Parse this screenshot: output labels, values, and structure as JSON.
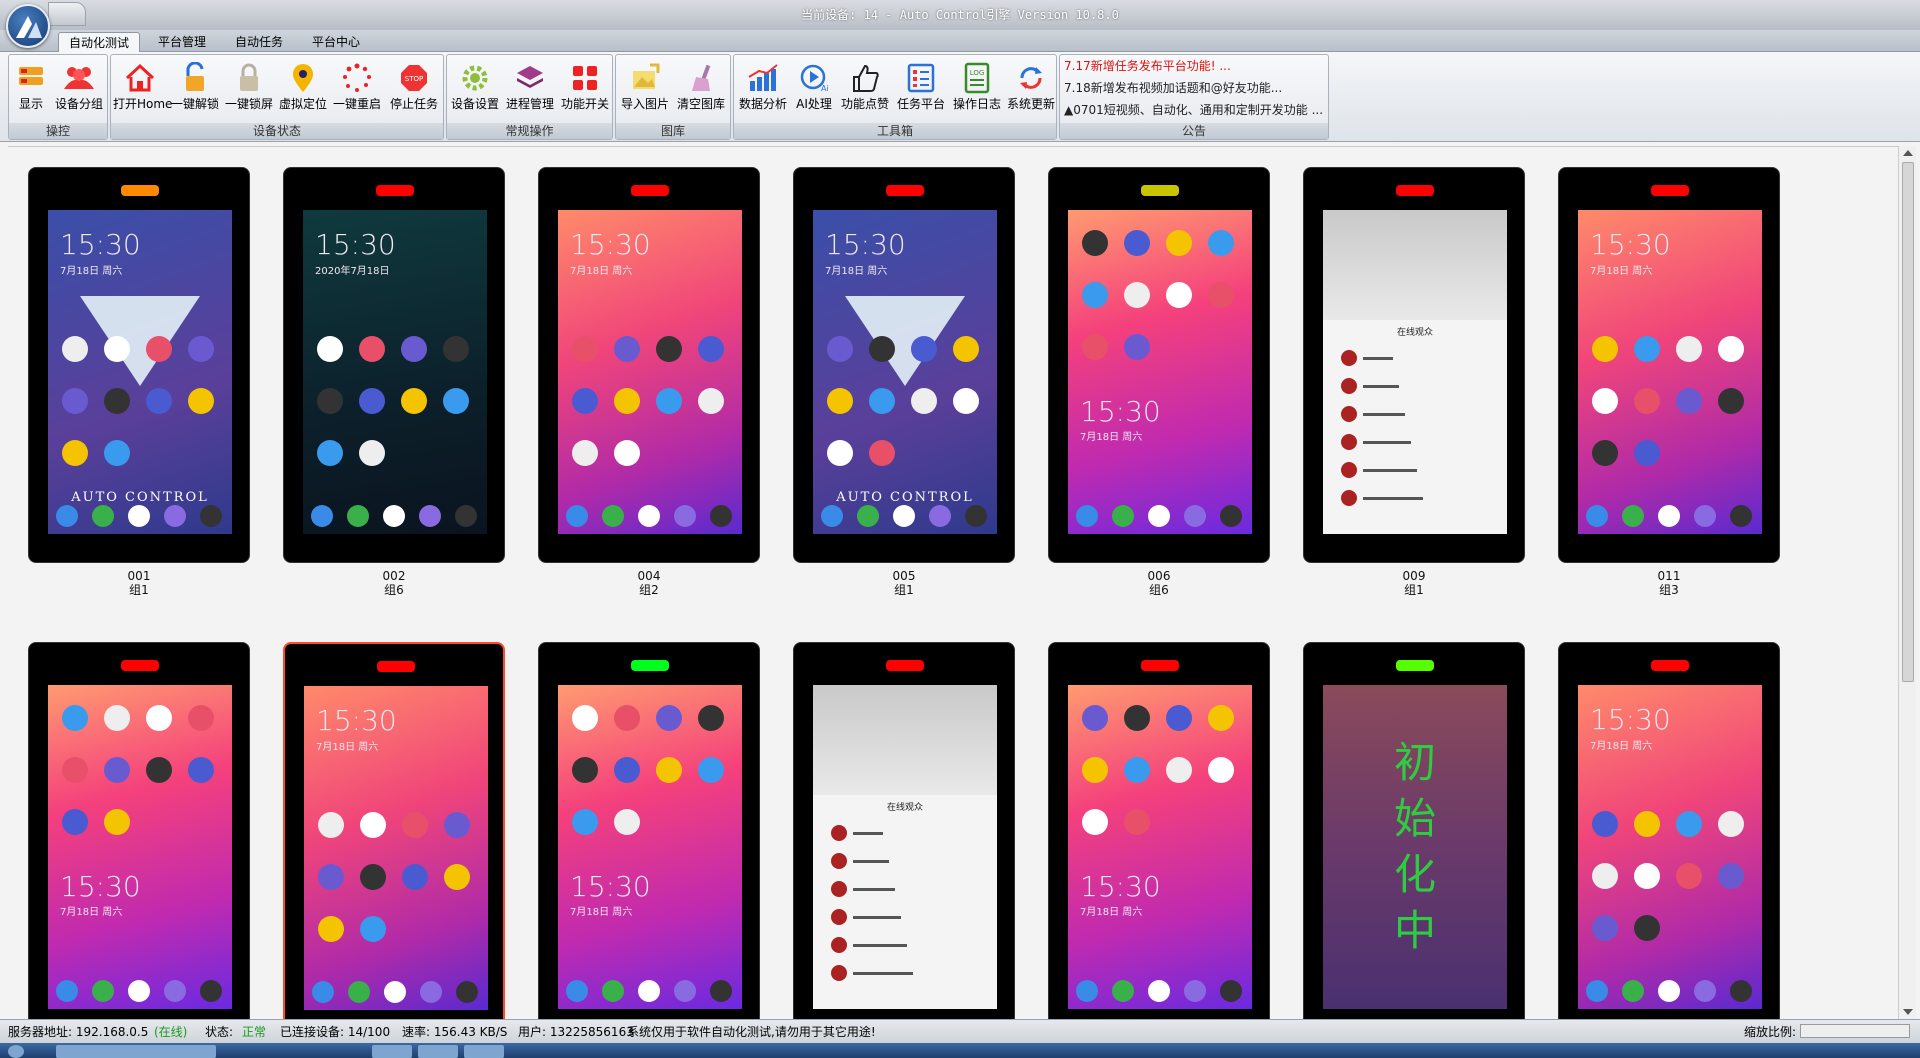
{
  "window": {
    "title": "当前设备: 14 - Auto Control引擎 Version 10.8.0"
  },
  "menu_tabs": [
    "自动化测试",
    "平台管理",
    "自动任务",
    "平台中心"
  ],
  "ribbon": {
    "groups": [
      {
        "title": "操控",
        "buttons": [
          {
            "label": "显示",
            "icon": "display-icon"
          },
          {
            "label": "设备分组",
            "icon": "device-group-icon"
          }
        ]
      },
      {
        "title": "设备状态",
        "buttons": [
          {
            "label": "打开Home",
            "icon": "home-icon"
          },
          {
            "label": "一键解锁",
            "icon": "unlock-icon"
          },
          {
            "label": "一键锁屏",
            "icon": "lock-icon"
          },
          {
            "label": "虚拟定位",
            "icon": "location-pin-icon"
          },
          {
            "label": "一键重启",
            "icon": "restart-icon"
          },
          {
            "label": "停止任务",
            "icon": "stop-icon"
          }
        ]
      },
      {
        "title": "常规操作",
        "buttons": [
          {
            "label": "设备设置",
            "icon": "gear-icon"
          },
          {
            "label": "进程管理",
            "icon": "layers-icon"
          },
          {
            "label": "功能开关",
            "icon": "grid-switch-icon"
          }
        ]
      },
      {
        "title": "图库",
        "buttons": [
          {
            "label": "导入图片",
            "icon": "import-image-icon"
          },
          {
            "label": "清空图库",
            "icon": "broom-icon"
          }
        ]
      },
      {
        "title": "工具箱",
        "buttons": [
          {
            "label": "数据分析",
            "icon": "bar-chart-icon"
          },
          {
            "label": "AI处理",
            "icon": "ai-icon"
          },
          {
            "label": "功能点赞",
            "icon": "thumbs-up-icon"
          },
          {
            "label": "任务平台",
            "icon": "task-list-icon"
          },
          {
            "label": "操作日志",
            "icon": "log-icon"
          },
          {
            "label": "系统更新",
            "icon": "update-icon"
          }
        ]
      },
      {
        "title": "公告",
        "notices": [
          "7.17新增任务发布平台功能! ...",
          "7.18新增发布视频加话题和@好友功能...",
          "▲0701短视频、自动化、通用和定制开发功能 ..."
        ]
      }
    ]
  },
  "devices": [
    {
      "id": "001",
      "group": "组1",
      "led": "#ff8a00",
      "screen": "ac"
    },
    {
      "id": "002",
      "group": "组6",
      "led": "#ff0000",
      "screen": "dark"
    },
    {
      "id": "004",
      "group": "组2",
      "led": "#ff0000",
      "screen": "pink"
    },
    {
      "id": "005",
      "group": "组1",
      "led": "#ff0000",
      "screen": "ac"
    },
    {
      "id": "006",
      "group": "组6",
      "led": "#c8c400",
      "screen": "pink2"
    },
    {
      "id": "009",
      "group": "组1",
      "led": "#ff0000",
      "screen": "live"
    },
    {
      "id": "011",
      "group": "组3",
      "led": "#ff0000",
      "screen": "pink"
    },
    {
      "id": "",
      "group": "",
      "led": "#ff0000",
      "screen": "pink2"
    },
    {
      "id": "",
      "group": "",
      "led": "#ff0000",
      "screen": "pink"
    },
    {
      "id": "",
      "group": "",
      "led": "#00ff1a",
      "screen": "pink2"
    },
    {
      "id": "",
      "group": "",
      "led": "#ff0000",
      "screen": "live"
    },
    {
      "id": "",
      "group": "",
      "led": "#ff0000",
      "screen": "pink2"
    },
    {
      "id": "",
      "group": "",
      "led": "#55ff00",
      "screen": "init"
    },
    {
      "id": "",
      "group": "",
      "led": "#ff0000",
      "screen": "pink"
    }
  ],
  "screen_text": {
    "time": "15:30",
    "date_dark": "2020年7月18日",
    "date_pink": "7月18日 周六",
    "brand": "AUTO CONTROL",
    "initializing": "初\n始\n化\n中",
    "live_title": "在线观众"
  },
  "statusbar": {
    "server_label": "服务器地址: 192.168.0.5",
    "server_state": "(在线)",
    "status_label": "状态:",
    "status_value": "正常",
    "connected": "已连接设备: 14/100",
    "rate": "速率: 156.43 KB/S",
    "user": "用户: 13225856163",
    "notice": "系统仅用于软件自动化测试,请勿用于其它用途!",
    "zoom_label": "缩放比例:"
  },
  "colors": {
    "accent_red": "#d11",
    "online_green": "#1a9a1a",
    "selected_border": "#ff4a2a"
  }
}
